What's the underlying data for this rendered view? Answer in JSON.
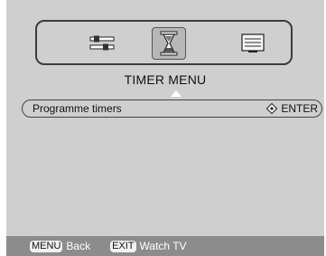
{
  "menu": {
    "title": "TIMER MENU"
  },
  "tabs": [
    {
      "name": "settings",
      "icon": "sliders-icon",
      "selected": false
    },
    {
      "name": "timer",
      "icon": "hourglass-icon",
      "selected": true
    },
    {
      "name": "screen",
      "icon": "screen-icon",
      "selected": false
    }
  ],
  "rows": [
    {
      "label": "Programme timers",
      "action": "ENTER",
      "action_icon": "navigate-diamond-icon"
    }
  ],
  "footer": {
    "back_key": "MENU",
    "back_label": "Back",
    "exit_key": "EXIT",
    "exit_label": "Watch TV"
  },
  "colors": {
    "background": "#cfcfcf",
    "footer": "#8c8c8c",
    "selected_tab": "#b8b8b8"
  }
}
